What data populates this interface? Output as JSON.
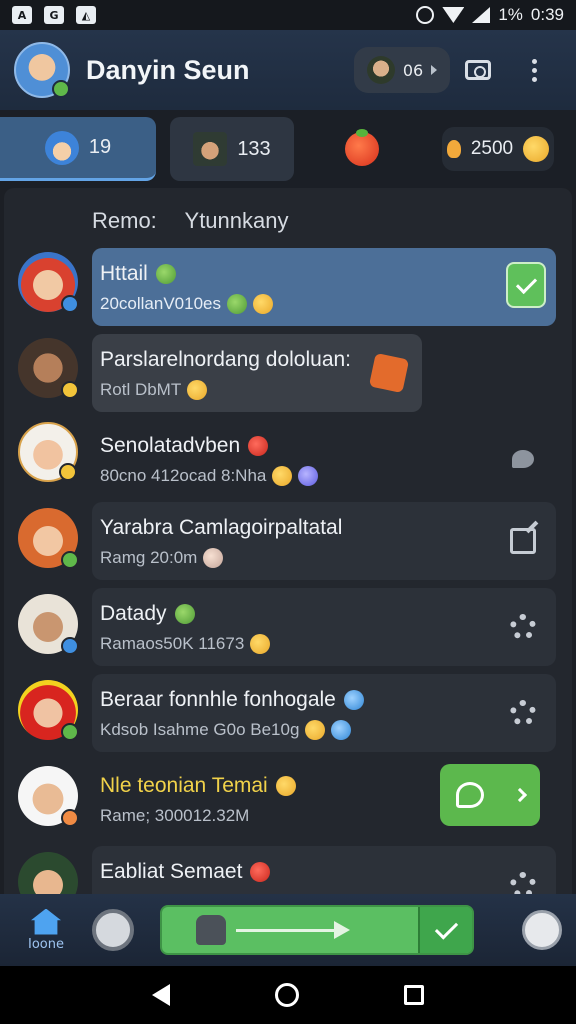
{
  "status_bar": {
    "battery": "1%",
    "time": "0:39"
  },
  "header": {
    "title": "Danyin Seun",
    "chip_value": "06",
    "icons": [
      "camera-icon",
      "more-vertical-icon"
    ]
  },
  "tabs": [
    {
      "label": "19"
    },
    {
      "label": "133"
    },
    {
      "label": ""
    },
    {
      "label": "2500"
    }
  ],
  "subheader": {
    "label": "Remo:",
    "value": "Ytunnkany"
  },
  "contacts": [
    {
      "name": "Httail",
      "sub": "20collanV010es",
      "state": "active",
      "action": "check-icon"
    },
    {
      "name": "Parslarelnordang dololuan:",
      "sub": "Rotl   DbMT",
      "state": "pending",
      "action": "edit-orange-icon"
    },
    {
      "name": "Senolatadvben",
      "sub": "80cno   412ocad     8:Nha",
      "state": "plain",
      "action": "bubble-icon"
    },
    {
      "name": "Yarabra Camlagoirpaltatal",
      "sub": "Ramg   20:0m",
      "state": "card",
      "action": "edit-icon"
    },
    {
      "name": "Datady",
      "sub": "Ramaos50K 11673",
      "state": "card",
      "action": "settings-icon"
    },
    {
      "name": "Beraar fonnhle fonhogale",
      "sub": "Kdsob Isahme    G0o Be10g",
      "state": "card",
      "action": "settings-icon"
    },
    {
      "name": "Nle teonian Temai",
      "sub": "Rame; 300012.32M",
      "state": "highlight",
      "action": "chat-icon"
    },
    {
      "name": "Eabliat Semaet",
      "sub": "",
      "state": "card",
      "action": "settings-icon"
    }
  ],
  "bottom_nav": {
    "home_label": "Ioone",
    "progress": 0.85
  }
}
